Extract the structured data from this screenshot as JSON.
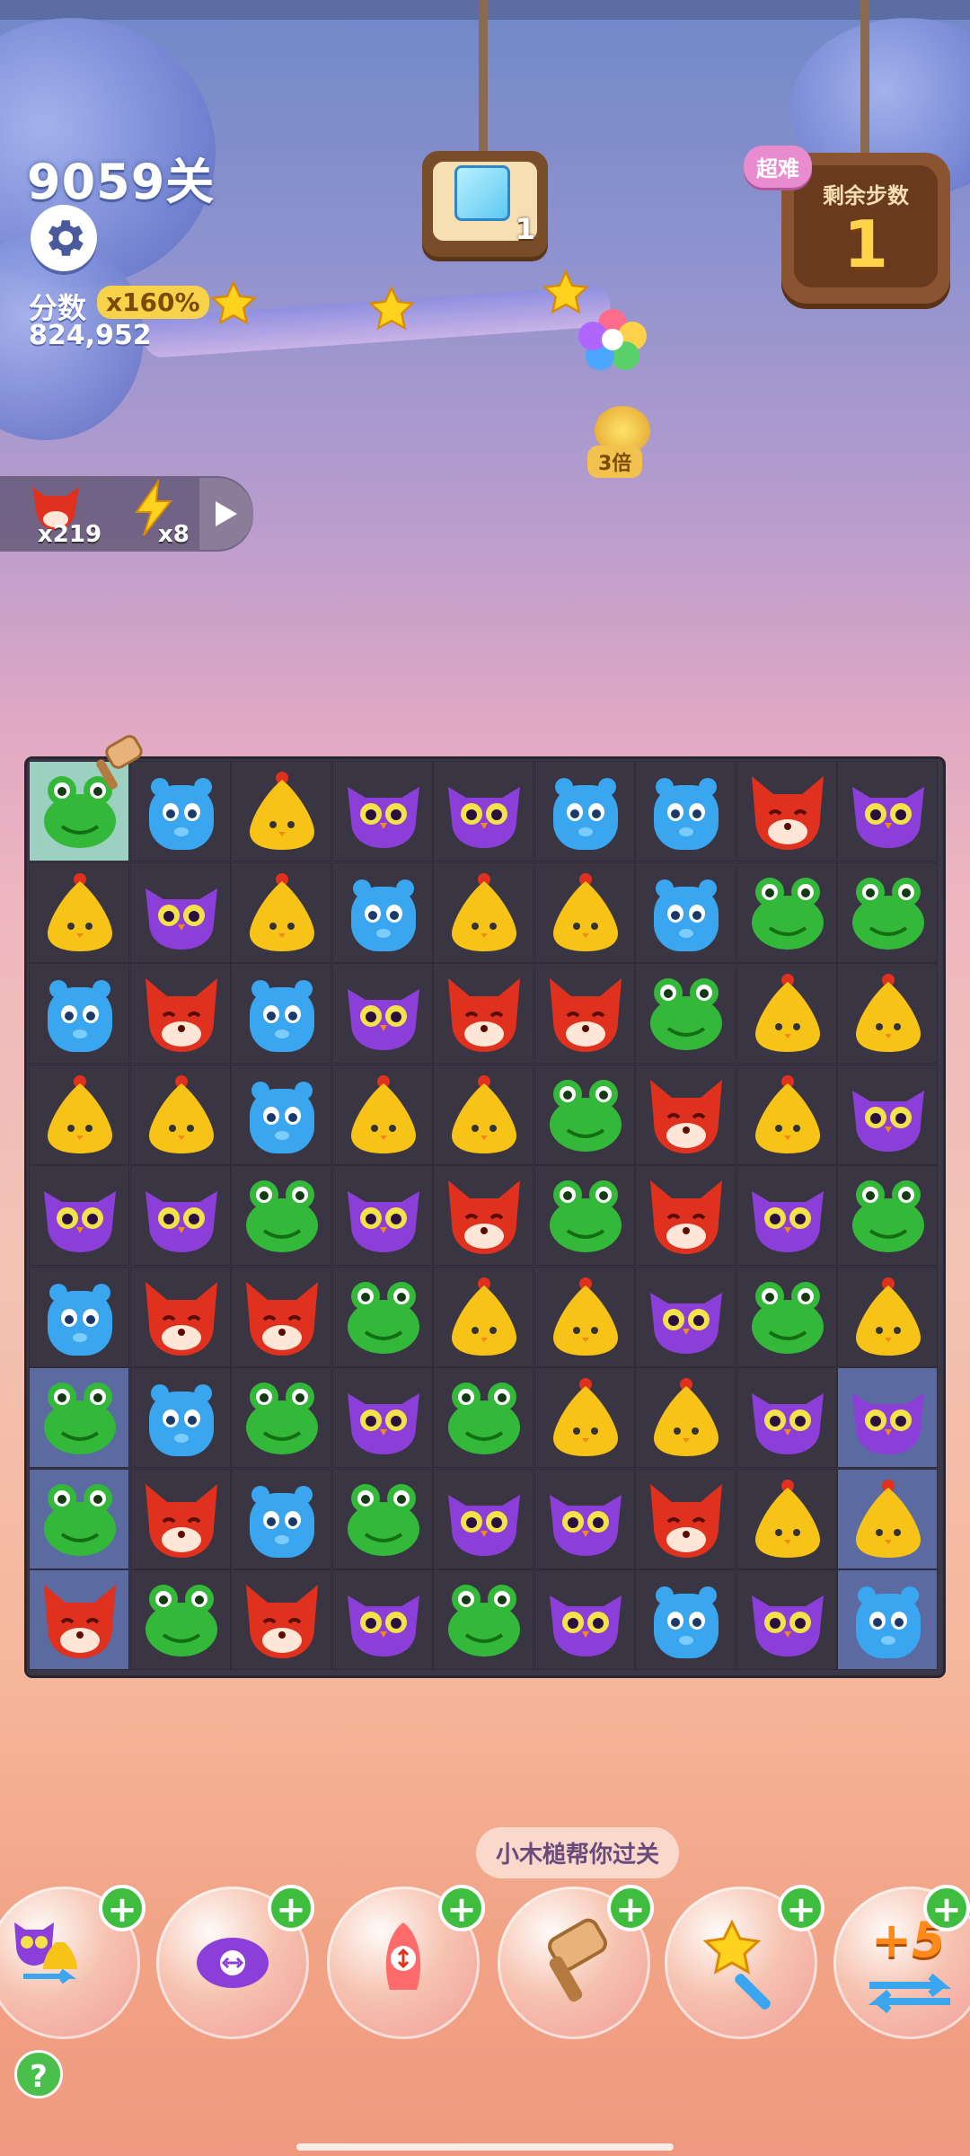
{
  "level_label": "9059关",
  "score": {
    "label": "分数",
    "multiplier": "x160%",
    "value": "824,952"
  },
  "goal": {
    "count": "1"
  },
  "moves": {
    "label": "剩余步数",
    "value": "1",
    "difficulty": "超难"
  },
  "bonus": {
    "label": "3倍"
  },
  "bag": {
    "fox_count": "x219",
    "lightning_count": "x8"
  },
  "tip": "小木槌帮你过关",
  "booster_plus_label": "+5",
  "help_label": "?",
  "colors": {
    "red": "#e0301e",
    "blue": "#39a6ef",
    "yellow": "#f6c316",
    "purple": "#8c3ed8",
    "green": "#34b83a"
  },
  "board": [
    [
      "green",
      "blue",
      "yellow",
      "purple",
      "purple",
      "blue",
      "blue",
      "red",
      "purple"
    ],
    [
      "yellow",
      "purple",
      "yellow",
      "blue",
      "yellow",
      "yellow",
      "blue",
      "green",
      "green"
    ],
    [
      "blue",
      "red",
      "blue",
      "purple",
      "red",
      "red",
      "green",
      "yellow",
      "yellow"
    ],
    [
      "yellow",
      "yellow",
      "blue",
      "yellow",
      "yellow",
      "green",
      "red",
      "yellow",
      "purple"
    ],
    [
      "purple",
      "purple",
      "green",
      "purple",
      "red",
      "green",
      "red",
      "purple",
      "green"
    ],
    [
      "blue",
      "red",
      "red",
      "green",
      "yellow",
      "yellow",
      "purple",
      "green",
      "yellow"
    ],
    [
      "green",
      "blue",
      "green",
      "purple",
      "green",
      "yellow",
      "yellow",
      "purple",
      "purple"
    ],
    [
      "green",
      "red",
      "blue",
      "green",
      "purple",
      "purple",
      "red",
      "yellow",
      "yellow"
    ],
    [
      "red",
      "green",
      "red",
      "purple",
      "green",
      "purple",
      "blue",
      "purple",
      "blue"
    ]
  ],
  "boosters": [
    {
      "name": "swap-booster",
      "icon": "owl-chick-swap-icon"
    },
    {
      "name": "rocket-disc-booster",
      "icon": "disc-icon"
    },
    {
      "name": "rocket-booster",
      "icon": "rocket-icon"
    },
    {
      "name": "hammer-booster",
      "icon": "hammer-icon"
    },
    {
      "name": "magic-wand-booster",
      "icon": "wand-icon"
    },
    {
      "name": "plus-five-booster",
      "icon": "plus-five-icon"
    }
  ]
}
